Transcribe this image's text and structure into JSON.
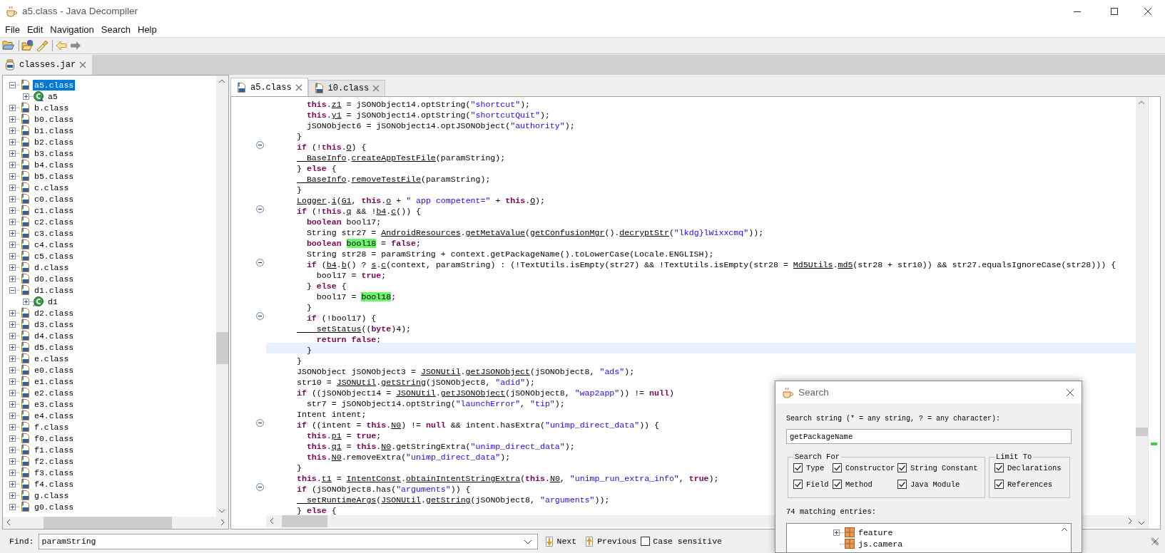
{
  "window": {
    "title": "a5.class - Java Decompiler"
  },
  "menu": [
    "File",
    "Edit",
    "Navigation",
    "Search",
    "Help"
  ],
  "workspace_tabs": [
    {
      "label": "classes.jar",
      "selected": true
    }
  ],
  "tree": {
    "items": [
      {
        "label": "a5.class",
        "kind": "file",
        "expanded": true,
        "selected": true,
        "children": [
          {
            "label": "a5",
            "kind": "class",
            "expanded": false,
            "selected": false
          }
        ]
      },
      {
        "label": "b.class",
        "kind": "file",
        "expanded": false,
        "selected": false
      },
      {
        "label": "b0.class",
        "kind": "file",
        "expanded": false,
        "selected": false
      },
      {
        "label": "b1.class",
        "kind": "file",
        "expanded": false,
        "selected": false
      },
      {
        "label": "b2.class",
        "kind": "file",
        "expanded": false,
        "selected": false
      },
      {
        "label": "b3.class",
        "kind": "file",
        "expanded": false,
        "selected": false
      },
      {
        "label": "b4.class",
        "kind": "file",
        "expanded": false,
        "selected": false
      },
      {
        "label": "b5.class",
        "kind": "file",
        "expanded": false,
        "selected": false
      },
      {
        "label": "c.class",
        "kind": "file",
        "expanded": false,
        "selected": false
      },
      {
        "label": "c0.class",
        "kind": "file",
        "expanded": false,
        "selected": false
      },
      {
        "label": "c1.class",
        "kind": "file",
        "expanded": false,
        "selected": false
      },
      {
        "label": "c2.class",
        "kind": "file",
        "expanded": false,
        "selected": false
      },
      {
        "label": "c3.class",
        "kind": "file",
        "expanded": false,
        "selected": false
      },
      {
        "label": "c4.class",
        "kind": "file",
        "expanded": false,
        "selected": false
      },
      {
        "label": "c5.class",
        "kind": "file",
        "expanded": false,
        "selected": false
      },
      {
        "label": "d.class",
        "kind": "file",
        "expanded": false,
        "selected": false
      },
      {
        "label": "d0.class",
        "kind": "file",
        "expanded": false,
        "selected": false
      },
      {
        "label": "d1.class",
        "kind": "file",
        "expanded": true,
        "selected": false,
        "children": [
          {
            "label": "d1",
            "kind": "abstract_class",
            "expanded": false,
            "selected": false
          }
        ]
      },
      {
        "label": "d2.class",
        "kind": "file",
        "expanded": false,
        "selected": false
      },
      {
        "label": "d3.class",
        "kind": "file",
        "expanded": false,
        "selected": false
      },
      {
        "label": "d4.class",
        "kind": "file",
        "expanded": false,
        "selected": false
      },
      {
        "label": "d5.class",
        "kind": "file",
        "expanded": false,
        "selected": false
      },
      {
        "label": "e.class",
        "kind": "file",
        "expanded": false,
        "selected": false
      },
      {
        "label": "e0.class",
        "kind": "file",
        "expanded": false,
        "selected": false
      },
      {
        "label": "e1.class",
        "kind": "file",
        "expanded": false,
        "selected": false
      },
      {
        "label": "e2.class",
        "kind": "file",
        "expanded": false,
        "selected": false
      },
      {
        "label": "e3.class",
        "kind": "file",
        "expanded": false,
        "selected": false
      },
      {
        "label": "e4.class",
        "kind": "file",
        "expanded": false,
        "selected": false
      },
      {
        "label": "f.class",
        "kind": "file",
        "expanded": false,
        "selected": false
      },
      {
        "label": "f0.class",
        "kind": "file",
        "expanded": false,
        "selected": false
      },
      {
        "label": "f1.class",
        "kind": "file",
        "expanded": false,
        "selected": false
      },
      {
        "label": "f2.class",
        "kind": "file",
        "expanded": false,
        "selected": false
      },
      {
        "label": "f3.class",
        "kind": "file",
        "expanded": false,
        "selected": false
      },
      {
        "label": "f4.class",
        "kind": "file",
        "expanded": false,
        "selected": false
      },
      {
        "label": "g.class",
        "kind": "file",
        "expanded": false,
        "selected": false
      },
      {
        "label": "g0.class",
        "kind": "file",
        "expanded": false,
        "selected": false
      }
    ]
  },
  "editor": {
    "tabs": [
      {
        "label": "a5.class",
        "selected": true
      },
      {
        "label": "i0.class",
        "selected": false
      }
    ],
    "lines": [
      {
        "fold": false,
        "current": false,
        "tokens": [
          {
            "kind": "keyword",
            "text": "  this"
          },
          {
            "kind": "plain",
            "text": "."
          },
          {
            "kind": "reference",
            "text": "z1"
          },
          {
            "kind": "plain",
            "text": " = jSONObject14.optString("
          },
          {
            "kind": "string",
            "text": "\"shortcut\""
          },
          {
            "kind": "plain",
            "text": ");"
          }
        ]
      },
      {
        "fold": false,
        "current": false,
        "tokens": [
          {
            "kind": "keyword",
            "text": "  this"
          },
          {
            "kind": "plain",
            "text": "."
          },
          {
            "kind": "reference",
            "text": "y1"
          },
          {
            "kind": "plain",
            "text": " = jSONObject14.optString("
          },
          {
            "kind": "string",
            "text": "\"shortcutQuit\""
          },
          {
            "kind": "plain",
            "text": ");"
          }
        ]
      },
      {
        "fold": false,
        "current": false,
        "tokens": [
          {
            "kind": "plain",
            "text": "  jSONObject6 = jSONObject14.optJSONObject("
          },
          {
            "kind": "string",
            "text": "\"authority\""
          },
          {
            "kind": "plain",
            "text": ");"
          }
        ]
      },
      {
        "fold": false,
        "current": false,
        "tokens": [
          {
            "kind": "plain",
            "text": "}"
          }
        ]
      },
      {
        "fold": true,
        "current": false,
        "tokens": [
          {
            "kind": "keyword",
            "text": "if"
          },
          {
            "kind": "plain",
            "text": " (!"
          },
          {
            "kind": "keyword",
            "text": "this"
          },
          {
            "kind": "plain",
            "text": "."
          },
          {
            "kind": "reference",
            "text": "O"
          },
          {
            "kind": "plain",
            "text": ") {"
          }
        ]
      },
      {
        "fold": false,
        "current": false,
        "tokens": [
          {
            "kind": "reference",
            "text": "  BaseInfo"
          },
          {
            "kind": "plain",
            "text": "."
          },
          {
            "kind": "reference",
            "text": "createAppTestFile"
          },
          {
            "kind": "plain",
            "text": "(paramString);"
          }
        ]
      },
      {
        "fold": false,
        "current": false,
        "tokens": [
          {
            "kind": "plain",
            "text": "} "
          },
          {
            "kind": "keyword",
            "text": "else"
          },
          {
            "kind": "plain",
            "text": " {"
          }
        ]
      },
      {
        "fold": false,
        "current": false,
        "tokens": [
          {
            "kind": "reference",
            "text": "  BaseInfo"
          },
          {
            "kind": "plain",
            "text": "."
          },
          {
            "kind": "reference",
            "text": "removeTestFile"
          },
          {
            "kind": "plain",
            "text": "(paramString);"
          }
        ]
      },
      {
        "fold": false,
        "current": false,
        "tokens": [
          {
            "kind": "plain",
            "text": "}"
          }
        ]
      },
      {
        "fold": false,
        "current": false,
        "tokens": [
          {
            "kind": "reference",
            "text": "Logger"
          },
          {
            "kind": "plain",
            "text": "."
          },
          {
            "kind": "reference",
            "text": "i"
          },
          {
            "kind": "plain",
            "text": "("
          },
          {
            "kind": "reference",
            "text": "G1"
          },
          {
            "kind": "plain",
            "text": ", "
          },
          {
            "kind": "keyword",
            "text": "this"
          },
          {
            "kind": "plain",
            "text": "."
          },
          {
            "kind": "reference",
            "text": "o"
          },
          {
            "kind": "plain",
            "text": " + "
          },
          {
            "kind": "string",
            "text": "\" app competent=\""
          },
          {
            "kind": "plain",
            "text": " + "
          },
          {
            "kind": "keyword",
            "text": "this"
          },
          {
            "kind": "plain",
            "text": "."
          },
          {
            "kind": "reference",
            "text": "O"
          },
          {
            "kind": "plain",
            "text": ");"
          }
        ]
      },
      {
        "fold": true,
        "current": false,
        "tokens": [
          {
            "kind": "keyword",
            "text": "if"
          },
          {
            "kind": "plain",
            "text": " (!"
          },
          {
            "kind": "keyword",
            "text": "this"
          },
          {
            "kind": "plain",
            "text": "."
          },
          {
            "kind": "reference",
            "text": "q"
          },
          {
            "kind": "plain",
            "text": " && !"
          },
          {
            "kind": "reference",
            "text": "b4"
          },
          {
            "kind": "plain",
            "text": "."
          },
          {
            "kind": "reference",
            "text": "c"
          },
          {
            "kind": "plain",
            "text": "()) {"
          }
        ]
      },
      {
        "fold": false,
        "current": false,
        "tokens": [
          {
            "kind": "keyword",
            "text": "  boolean"
          },
          {
            "kind": "plain",
            "text": " bool17;"
          }
        ]
      },
      {
        "fold": false,
        "current": false,
        "tokens": [
          {
            "kind": "plain",
            "text": "  String str27 = "
          },
          {
            "kind": "reference",
            "text": "AndroidResources"
          },
          {
            "kind": "plain",
            "text": "."
          },
          {
            "kind": "reference",
            "text": "getMetaValue"
          },
          {
            "kind": "plain",
            "text": "("
          },
          {
            "kind": "reference",
            "text": "getConfusionMgr"
          },
          {
            "kind": "plain",
            "text": "()."
          },
          {
            "kind": "reference",
            "text": "decryptStr"
          },
          {
            "kind": "plain",
            "text": "("
          },
          {
            "kind": "string",
            "text": "\"lkdg}lWixxcmq\""
          },
          {
            "kind": "plain",
            "text": "));"
          }
        ]
      },
      {
        "fold": false,
        "current": false,
        "tokens": [
          {
            "kind": "keyword",
            "text": "  boolean "
          },
          {
            "kind": "match",
            "text": "bool18"
          },
          {
            "kind": "plain",
            "text": " = "
          },
          {
            "kind": "keyword",
            "text": "false"
          },
          {
            "kind": "plain",
            "text": ";"
          }
        ]
      },
      {
        "fold": false,
        "current": false,
        "tokens": [
          {
            "kind": "plain",
            "text": "  String str28 = paramString + context.getPackageName().toLowerCase(Locale.ENGLISH);"
          }
        ]
      },
      {
        "fold": true,
        "current": false,
        "tokens": [
          {
            "kind": "keyword",
            "text": "  if"
          },
          {
            "kind": "plain",
            "text": " ("
          },
          {
            "kind": "reference",
            "text": "b4"
          },
          {
            "kind": "plain",
            "text": "."
          },
          {
            "kind": "reference",
            "text": "b"
          },
          {
            "kind": "plain",
            "text": "() ? "
          },
          {
            "kind": "reference",
            "text": "s"
          },
          {
            "kind": "plain",
            "text": "."
          },
          {
            "kind": "reference",
            "text": "c"
          },
          {
            "kind": "plain",
            "text": "(context, paramString) : (!TextUtils.isEmpty(str27) && !TextUtils.isEmpty(str28 = "
          },
          {
            "kind": "reference",
            "text": "Md5Utils"
          },
          {
            "kind": "plain",
            "text": "."
          },
          {
            "kind": "reference",
            "text": "md5"
          },
          {
            "kind": "plain",
            "text": "(str28 + str10)) && str27.equalsIgnoreCase(str28))) {"
          }
        ]
      },
      {
        "fold": false,
        "current": false,
        "tokens": [
          {
            "kind": "plain",
            "text": "    bool17 = "
          },
          {
            "kind": "keyword",
            "text": "true"
          },
          {
            "kind": "plain",
            "text": ";"
          }
        ]
      },
      {
        "fold": false,
        "current": false,
        "tokens": [
          {
            "kind": "plain",
            "text": "  } "
          },
          {
            "kind": "keyword",
            "text": "else"
          },
          {
            "kind": "plain",
            "text": " {"
          }
        ]
      },
      {
        "fold": false,
        "current": false,
        "tokens": [
          {
            "kind": "plain",
            "text": "    bool17 = "
          },
          {
            "kind": "match",
            "text": "bool18"
          },
          {
            "kind": "plain",
            "text": ";"
          }
        ]
      },
      {
        "fold": false,
        "current": false,
        "tokens": [
          {
            "kind": "plain",
            "text": "  }"
          }
        ]
      },
      {
        "fold": true,
        "current": false,
        "tokens": [
          {
            "kind": "keyword",
            "text": "  if"
          },
          {
            "kind": "plain",
            "text": " (!bool17) {"
          }
        ]
      },
      {
        "fold": false,
        "current": false,
        "tokens": [
          {
            "kind": "reference",
            "text": "    setStatus"
          },
          {
            "kind": "plain",
            "text": "(("
          },
          {
            "kind": "keyword",
            "text": "byte"
          },
          {
            "kind": "plain",
            "text": ")4);"
          }
        ]
      },
      {
        "fold": false,
        "current": false,
        "tokens": [
          {
            "kind": "keyword",
            "text": "    return false"
          },
          {
            "kind": "plain",
            "text": ";"
          }
        ]
      },
      {
        "fold": false,
        "current": true,
        "tokens": [
          {
            "kind": "plain",
            "text": "  }"
          }
        ]
      },
      {
        "fold": false,
        "current": false,
        "tokens": [
          {
            "kind": "plain",
            "text": "}"
          }
        ]
      },
      {
        "fold": false,
        "current": false,
        "tokens": [
          {
            "kind": "plain",
            "text": "JSONObject jSONObject3 = "
          },
          {
            "kind": "reference",
            "text": "JSONUtil"
          },
          {
            "kind": "plain",
            "text": "."
          },
          {
            "kind": "reference",
            "text": "getJSONObject"
          },
          {
            "kind": "plain",
            "text": "(jSONObject8, "
          },
          {
            "kind": "string",
            "text": "\"ads\""
          },
          {
            "kind": "plain",
            "text": ");"
          }
        ]
      },
      {
        "fold": false,
        "current": false,
        "tokens": [
          {
            "kind": "plain",
            "text": "str10 = "
          },
          {
            "kind": "reference",
            "text": "JSONUtil"
          },
          {
            "kind": "plain",
            "text": "."
          },
          {
            "kind": "reference",
            "text": "getString"
          },
          {
            "kind": "plain",
            "text": "(jSONObject8, "
          },
          {
            "kind": "string",
            "text": "\"adid\""
          },
          {
            "kind": "plain",
            "text": ");"
          }
        ]
      },
      {
        "fold": false,
        "current": false,
        "tokens": [
          {
            "kind": "keyword",
            "text": "if"
          },
          {
            "kind": "plain",
            "text": " ((jSONObject14 = "
          },
          {
            "kind": "reference",
            "text": "JSONUtil"
          },
          {
            "kind": "plain",
            "text": "."
          },
          {
            "kind": "reference",
            "text": "getJSONObject"
          },
          {
            "kind": "plain",
            "text": "(jSONObject8, "
          },
          {
            "kind": "string",
            "text": "\"wap2app\""
          },
          {
            "kind": "plain",
            "text": ")) != "
          },
          {
            "kind": "keyword",
            "text": "null"
          },
          {
            "kind": "plain",
            "text": ")"
          }
        ]
      },
      {
        "fold": false,
        "current": false,
        "tokens": [
          {
            "kind": "plain",
            "text": "  str7 = jSONObject14.optString("
          },
          {
            "kind": "string",
            "text": "\"launchError\""
          },
          {
            "kind": "plain",
            "text": ", "
          },
          {
            "kind": "string",
            "text": "\"tip\""
          },
          {
            "kind": "plain",
            "text": ");"
          }
        ]
      },
      {
        "fold": false,
        "current": false,
        "tokens": [
          {
            "kind": "plain",
            "text": "Intent intent;"
          }
        ]
      },
      {
        "fold": true,
        "current": false,
        "tokens": [
          {
            "kind": "keyword",
            "text": "if"
          },
          {
            "kind": "plain",
            "text": " ((intent = "
          },
          {
            "kind": "keyword",
            "text": "this"
          },
          {
            "kind": "plain",
            "text": "."
          },
          {
            "kind": "reference",
            "text": "N0"
          },
          {
            "kind": "plain",
            "text": ") != "
          },
          {
            "kind": "keyword",
            "text": "null"
          },
          {
            "kind": "plain",
            "text": " && intent.hasExtra("
          },
          {
            "kind": "string",
            "text": "\"unimp_direct_data\""
          },
          {
            "kind": "plain",
            "text": ")) {"
          }
        ]
      },
      {
        "fold": false,
        "current": false,
        "tokens": [
          {
            "kind": "keyword",
            "text": "  this"
          },
          {
            "kind": "plain",
            "text": "."
          },
          {
            "kind": "reference",
            "text": "p1"
          },
          {
            "kind": "plain",
            "text": " = "
          },
          {
            "kind": "keyword",
            "text": "true"
          },
          {
            "kind": "plain",
            "text": ";"
          }
        ]
      },
      {
        "fold": false,
        "current": false,
        "tokens": [
          {
            "kind": "keyword",
            "text": "  this"
          },
          {
            "kind": "plain",
            "text": "."
          },
          {
            "kind": "reference",
            "text": "q1"
          },
          {
            "kind": "plain",
            "text": " = "
          },
          {
            "kind": "keyword",
            "text": "this"
          },
          {
            "kind": "plain",
            "text": "."
          },
          {
            "kind": "reference",
            "text": "N0"
          },
          {
            "kind": "plain",
            "text": ".getStringExtra("
          },
          {
            "kind": "string",
            "text": "\"unimp_direct_data\""
          },
          {
            "kind": "plain",
            "text": ");"
          }
        ]
      },
      {
        "fold": false,
        "current": false,
        "tokens": [
          {
            "kind": "keyword",
            "text": "  this"
          },
          {
            "kind": "plain",
            "text": "."
          },
          {
            "kind": "reference",
            "text": "N0"
          },
          {
            "kind": "plain",
            "text": ".removeExtra("
          },
          {
            "kind": "string",
            "text": "\"unimp_direct_data\""
          },
          {
            "kind": "plain",
            "text": ");"
          }
        ]
      },
      {
        "fold": false,
        "current": false,
        "tokens": [
          {
            "kind": "plain",
            "text": "}"
          }
        ]
      },
      {
        "fold": false,
        "current": false,
        "tokens": [
          {
            "kind": "keyword",
            "text": "this"
          },
          {
            "kind": "plain",
            "text": "."
          },
          {
            "kind": "reference",
            "text": "t1"
          },
          {
            "kind": "plain",
            "text": " = "
          },
          {
            "kind": "reference",
            "text": "IntentConst"
          },
          {
            "kind": "plain",
            "text": "."
          },
          {
            "kind": "reference",
            "text": "obtainIntentStringExtra"
          },
          {
            "kind": "plain",
            "text": "("
          },
          {
            "kind": "keyword",
            "text": "this"
          },
          {
            "kind": "plain",
            "text": "."
          },
          {
            "kind": "reference",
            "text": "N0"
          },
          {
            "kind": "plain",
            "text": ", "
          },
          {
            "kind": "string",
            "text": "\"unimp_run_extra_info\""
          },
          {
            "kind": "plain",
            "text": ", "
          },
          {
            "kind": "keyword",
            "text": "true"
          },
          {
            "kind": "plain",
            "text": ");"
          }
        ]
      },
      {
        "fold": true,
        "current": false,
        "tokens": [
          {
            "kind": "keyword",
            "text": "if"
          },
          {
            "kind": "plain",
            "text": " (jSONObject8.has("
          },
          {
            "kind": "string",
            "text": "\"arguments\""
          },
          {
            "kind": "plain",
            "text": ")) {"
          }
        ]
      },
      {
        "fold": false,
        "current": false,
        "tokens": [
          {
            "kind": "reference",
            "text": "  setRuntimeArgs"
          },
          {
            "kind": "plain",
            "text": "("
          },
          {
            "kind": "reference",
            "text": "JSONUtil"
          },
          {
            "kind": "plain",
            "text": "."
          },
          {
            "kind": "reference",
            "text": "getString"
          },
          {
            "kind": "plain",
            "text": "(jSONObject8, "
          },
          {
            "kind": "string",
            "text": "\"arguments\""
          },
          {
            "kind": "plain",
            "text": "));"
          }
        ]
      },
      {
        "fold": false,
        "current": false,
        "tokens": [
          {
            "kind": "plain",
            "text": "} "
          },
          {
            "kind": "keyword",
            "text": "else"
          },
          {
            "kind": "plain",
            "text": " {"
          }
        ]
      }
    ]
  },
  "find_bar": {
    "label": "Find:",
    "value": "paramString",
    "next": "Next",
    "previous": "Previous",
    "case_sensitive": {
      "label": "Case sensitive",
      "checked": false
    }
  },
  "search_dialog": {
    "title": "Search",
    "prompt": "Search string (* = any string, ? = any character):",
    "value": "getPackageName",
    "search_for": {
      "title": "Search For",
      "options": [
        {
          "label": "Type",
          "checked": true
        },
        {
          "label": "Constructor",
          "checked": true
        },
        {
          "label": "String Constant",
          "checked": true
        },
        {
          "label": "Field",
          "checked": true
        },
        {
          "label": "Method",
          "checked": true
        },
        {
          "label": "Java Module",
          "checked": true
        }
      ]
    },
    "limit_to": {
      "title": "Limit To",
      "options": [
        {
          "label": "Declarations",
          "checked": true
        },
        {
          "label": "References",
          "checked": true
        }
      ]
    },
    "count": "74 matching entries:",
    "results": [
      {
        "label": "feature",
        "kind": "package",
        "expandable": true
      },
      {
        "label": "js.camera",
        "kind": "package",
        "expandable": false
      }
    ]
  }
}
